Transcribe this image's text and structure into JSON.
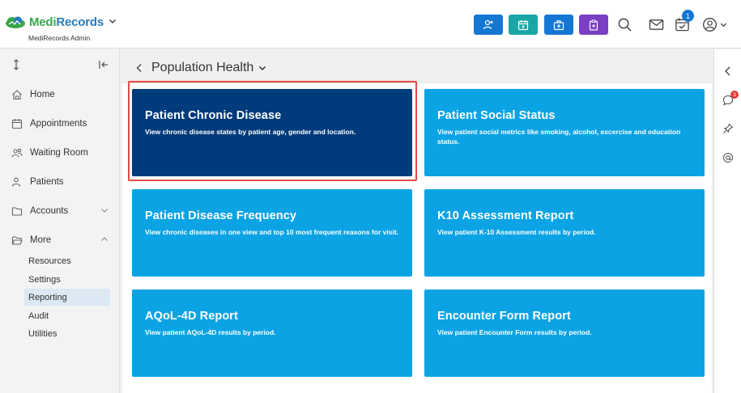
{
  "brand": {
    "name_part1": "Medi",
    "name_part2": "Records",
    "subtitle": "MediRecords Admin"
  },
  "header": {
    "actions": [
      {
        "icon": "add-patient-icon",
        "color": "#1577d4"
      },
      {
        "icon": "calendar-icon",
        "color": "#1aa6a6"
      },
      {
        "icon": "medical-kit-icon",
        "color": "#1577d4"
      },
      {
        "icon": "clipboard-icon",
        "color": "#7a3fc4"
      }
    ],
    "tasks_badge": "1"
  },
  "sidebar": {
    "items": [
      {
        "label": "Home",
        "icon": "home-icon"
      },
      {
        "label": "Appointments",
        "icon": "calendar-icon"
      },
      {
        "label": "Waiting Room",
        "icon": "people-icon"
      },
      {
        "label": "Patients",
        "icon": "user-icon"
      },
      {
        "label": "Accounts",
        "icon": "folder-icon"
      },
      {
        "label": "More",
        "icon": "folder-open-icon"
      }
    ],
    "sub_items": [
      "Resources",
      "Settings",
      "Reporting",
      "Audit",
      "Utilities"
    ],
    "active_sub_item": "Reporting"
  },
  "page": {
    "title": "Population Health"
  },
  "cards": [
    {
      "title": "Patient Chronic Disease",
      "desc": "View chronic disease states by patient age, gender and location.",
      "selected": true
    },
    {
      "title": "Patient Social Status",
      "desc": "View patient social metrics like smoking, alcohol, excercise and education status."
    },
    {
      "title": "Patient Disease Frequency",
      "desc": "View chronic diseases in one view and top 10 most frequent reasons for visit."
    },
    {
      "title": "K10 Assessment Report",
      "desc": "View patient K-10 Assessment results by period."
    },
    {
      "title": "AQoL-4D Report",
      "desc": "View patient AQoL-4D results by period."
    },
    {
      "title": "Encounter Form Report",
      "desc": "View patient Encounter Form results by period."
    }
  ],
  "rail": {
    "notification_badge": "3"
  },
  "colors": {
    "card": "#0ba3e4",
    "card_selected": "#003b7b",
    "highlight": "#e24a44"
  }
}
